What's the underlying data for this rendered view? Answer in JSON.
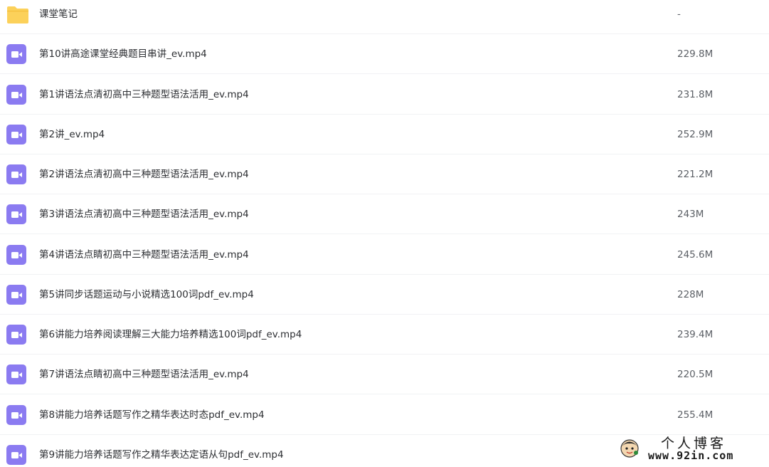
{
  "files": [
    {
      "name": "课堂笔记",
      "size": "-",
      "icon": "folder-icon"
    },
    {
      "name": "第10讲高途课堂经典题目串讲_ev.mp4",
      "size": "229.8M",
      "icon": "video-file-icon"
    },
    {
      "name": "第1讲语法点清初高中三种题型语法活用_ev.mp4",
      "size": "231.8M",
      "icon": "video-file-icon"
    },
    {
      "name": "第2讲_ev.mp4",
      "size": "252.9M",
      "icon": "video-file-icon"
    },
    {
      "name": "第2讲语法点清初高中三种题型语法活用_ev.mp4",
      "size": "221.2M",
      "icon": "video-file-icon"
    },
    {
      "name": "第3讲语法点清初高中三种题型语法活用_ev.mp4",
      "size": "243M",
      "icon": "video-file-icon"
    },
    {
      "name": "第4讲语法点睛初高中三种题型语法活用_ev.mp4",
      "size": "245.6M",
      "icon": "video-file-icon"
    },
    {
      "name": "第5讲同步话题运动与小说精选100词pdf_ev.mp4",
      "size": "228M",
      "icon": "video-file-icon"
    },
    {
      "name": "第6讲能力培养阅读理解三大能力培养精选100词pdf_ev.mp4",
      "size": "239.4M",
      "icon": "video-file-icon"
    },
    {
      "name": "第7讲语法点睛初高中三种题型语法活用_ev.mp4",
      "size": "220.5M",
      "icon": "video-file-icon"
    },
    {
      "name": "第8讲能力培养话题写作之精华表达时态pdf_ev.mp4",
      "size": "255.4M",
      "icon": "video-file-icon"
    },
    {
      "name": "第9讲能力培养话题写作之精华表达定语从句pdf_ev.mp4",
      "size": "",
      "icon": "video-file-icon"
    }
  ],
  "watermark": {
    "title": "个人博客",
    "url": "www.92in.com"
  },
  "colors": {
    "folder": "#fcd15a",
    "video_icon": "#8b7bf1",
    "divider": "#f1f2f4",
    "text": "#2d2f33",
    "size_text": "#5c6066"
  }
}
